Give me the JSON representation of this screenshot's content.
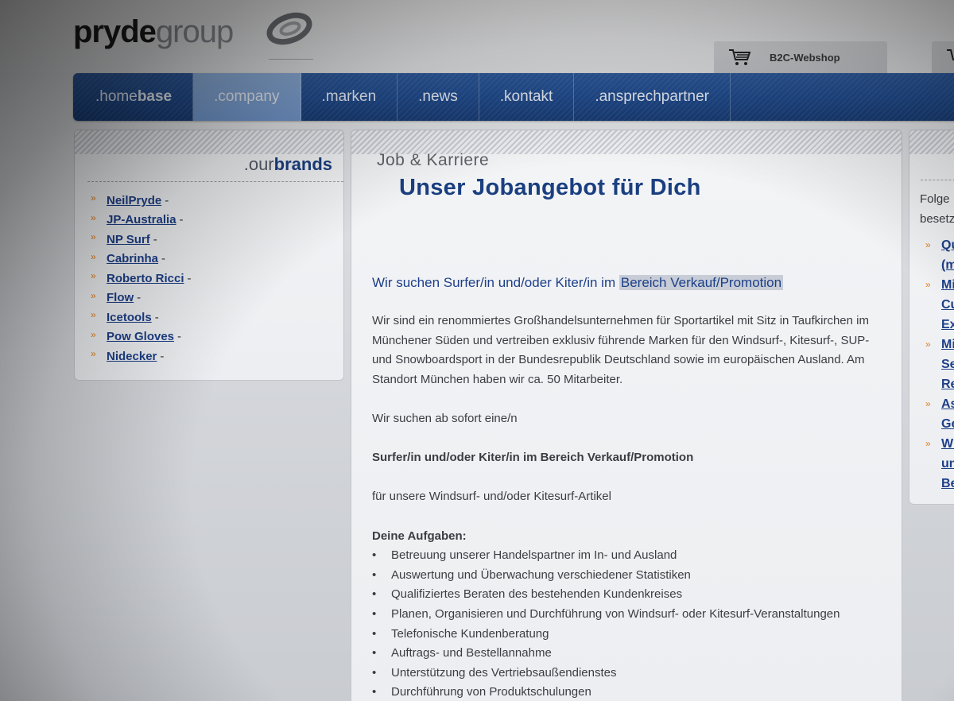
{
  "header": {
    "logo_bold": "pryde",
    "logo_light": "group",
    "shop_label": "B2C-Webshop"
  },
  "nav": {
    "items": [
      {
        "prefix": ".home",
        "bold": "base"
      },
      {
        "label": ".company"
      },
      {
        "label": ".marken"
      },
      {
        "label": ".news"
      },
      {
        "label": ".kontakt"
      },
      {
        "label": ".ansprechpartner"
      }
    ],
    "active_index": 1
  },
  "brands": {
    "title_light": ".our",
    "title_bold": "brands",
    "items": [
      "NeilPryde",
      "JP-Australia",
      "NP Surf",
      "Cabrinha",
      "Roberto Ricci",
      "Flow",
      "Icetools",
      "Pow Gloves",
      "Nidecker"
    ],
    "separator": "-"
  },
  "main": {
    "kicker": "Job & Karriere",
    "title": "Unser Jobangebot für Dich",
    "subtitle_plain": "Wir suchen Surfer/in und/oder Kiter/in im ",
    "subtitle_highlight": "Bereich Verkauf/Promotion",
    "paragraph1": "Wir sind ein renommiertes Großhandelsunternehmen für Sportartikel mit Sitz in Taufkirchen im Münchener Süden und vertreiben exklusiv führende Marken für den Windsurf-, Kitesurf-, SUP- und Snowboardsport in der Bundesrepublik Deutschland sowie im europäischen Ausland. Am Standort München haben wir ca. 50 Mitarbeiter.",
    "paragraph2": "Wir suchen ab sofort eine/n",
    "position": "Surfer/in und/oder Kiter/in im Bereich Verkauf/Promotion",
    "paragraph3": "für unsere Windsurf- und/oder Kitesurf-Artikel",
    "tasks_heading": "Deine Aufgaben:",
    "tasks": [
      "Betreuung unserer Handelspartner im In- und Ausland",
      "Auswertung und Überwachung verschiedener Statistiken",
      "Qualifiziertes Beraten des bestehenden Kundenkreises",
      "Planen, Organisieren und Durchführung von Windsurf- oder Kitesurf-Veranstaltungen",
      "Telefonische Kundenberatung",
      "Auftrags- und Bestellannahme",
      "Unterstützung des Vertriebsaußendienstes",
      "Durchführung von Produktschulungen"
    ]
  },
  "right": {
    "intro_line1": "Folge",
    "intro_line2": "besetz",
    "items": [
      [
        "Qu",
        "(m"
      ],
      [
        "Mi",
        "Cu",
        "Ex"
      ],
      [
        "Mi",
        "Se",
        "Re"
      ],
      [
        "As",
        "Ge"
      ],
      [
        "Wi",
        "un",
        "Be"
      ]
    ]
  }
}
